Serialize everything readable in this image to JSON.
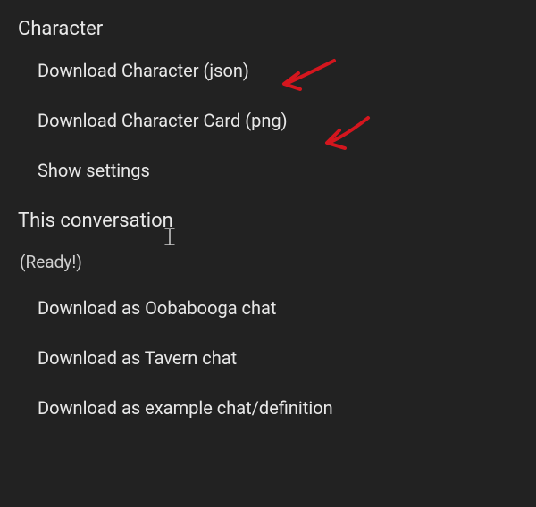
{
  "sections": {
    "character": {
      "header": "Character",
      "items": [
        {
          "label": "Download Character (json)"
        },
        {
          "label": "Download Character Card (png)"
        },
        {
          "label": "Show settings"
        }
      ]
    },
    "conversation": {
      "header": "This conversation",
      "status": "(Ready!)",
      "items": [
        {
          "label": "Download as Oobabooga chat"
        },
        {
          "label": "Download as Tavern chat"
        },
        {
          "label": "Download as example chat/definition"
        }
      ]
    }
  },
  "annotations": {
    "arrow_color": "#d4161e"
  }
}
